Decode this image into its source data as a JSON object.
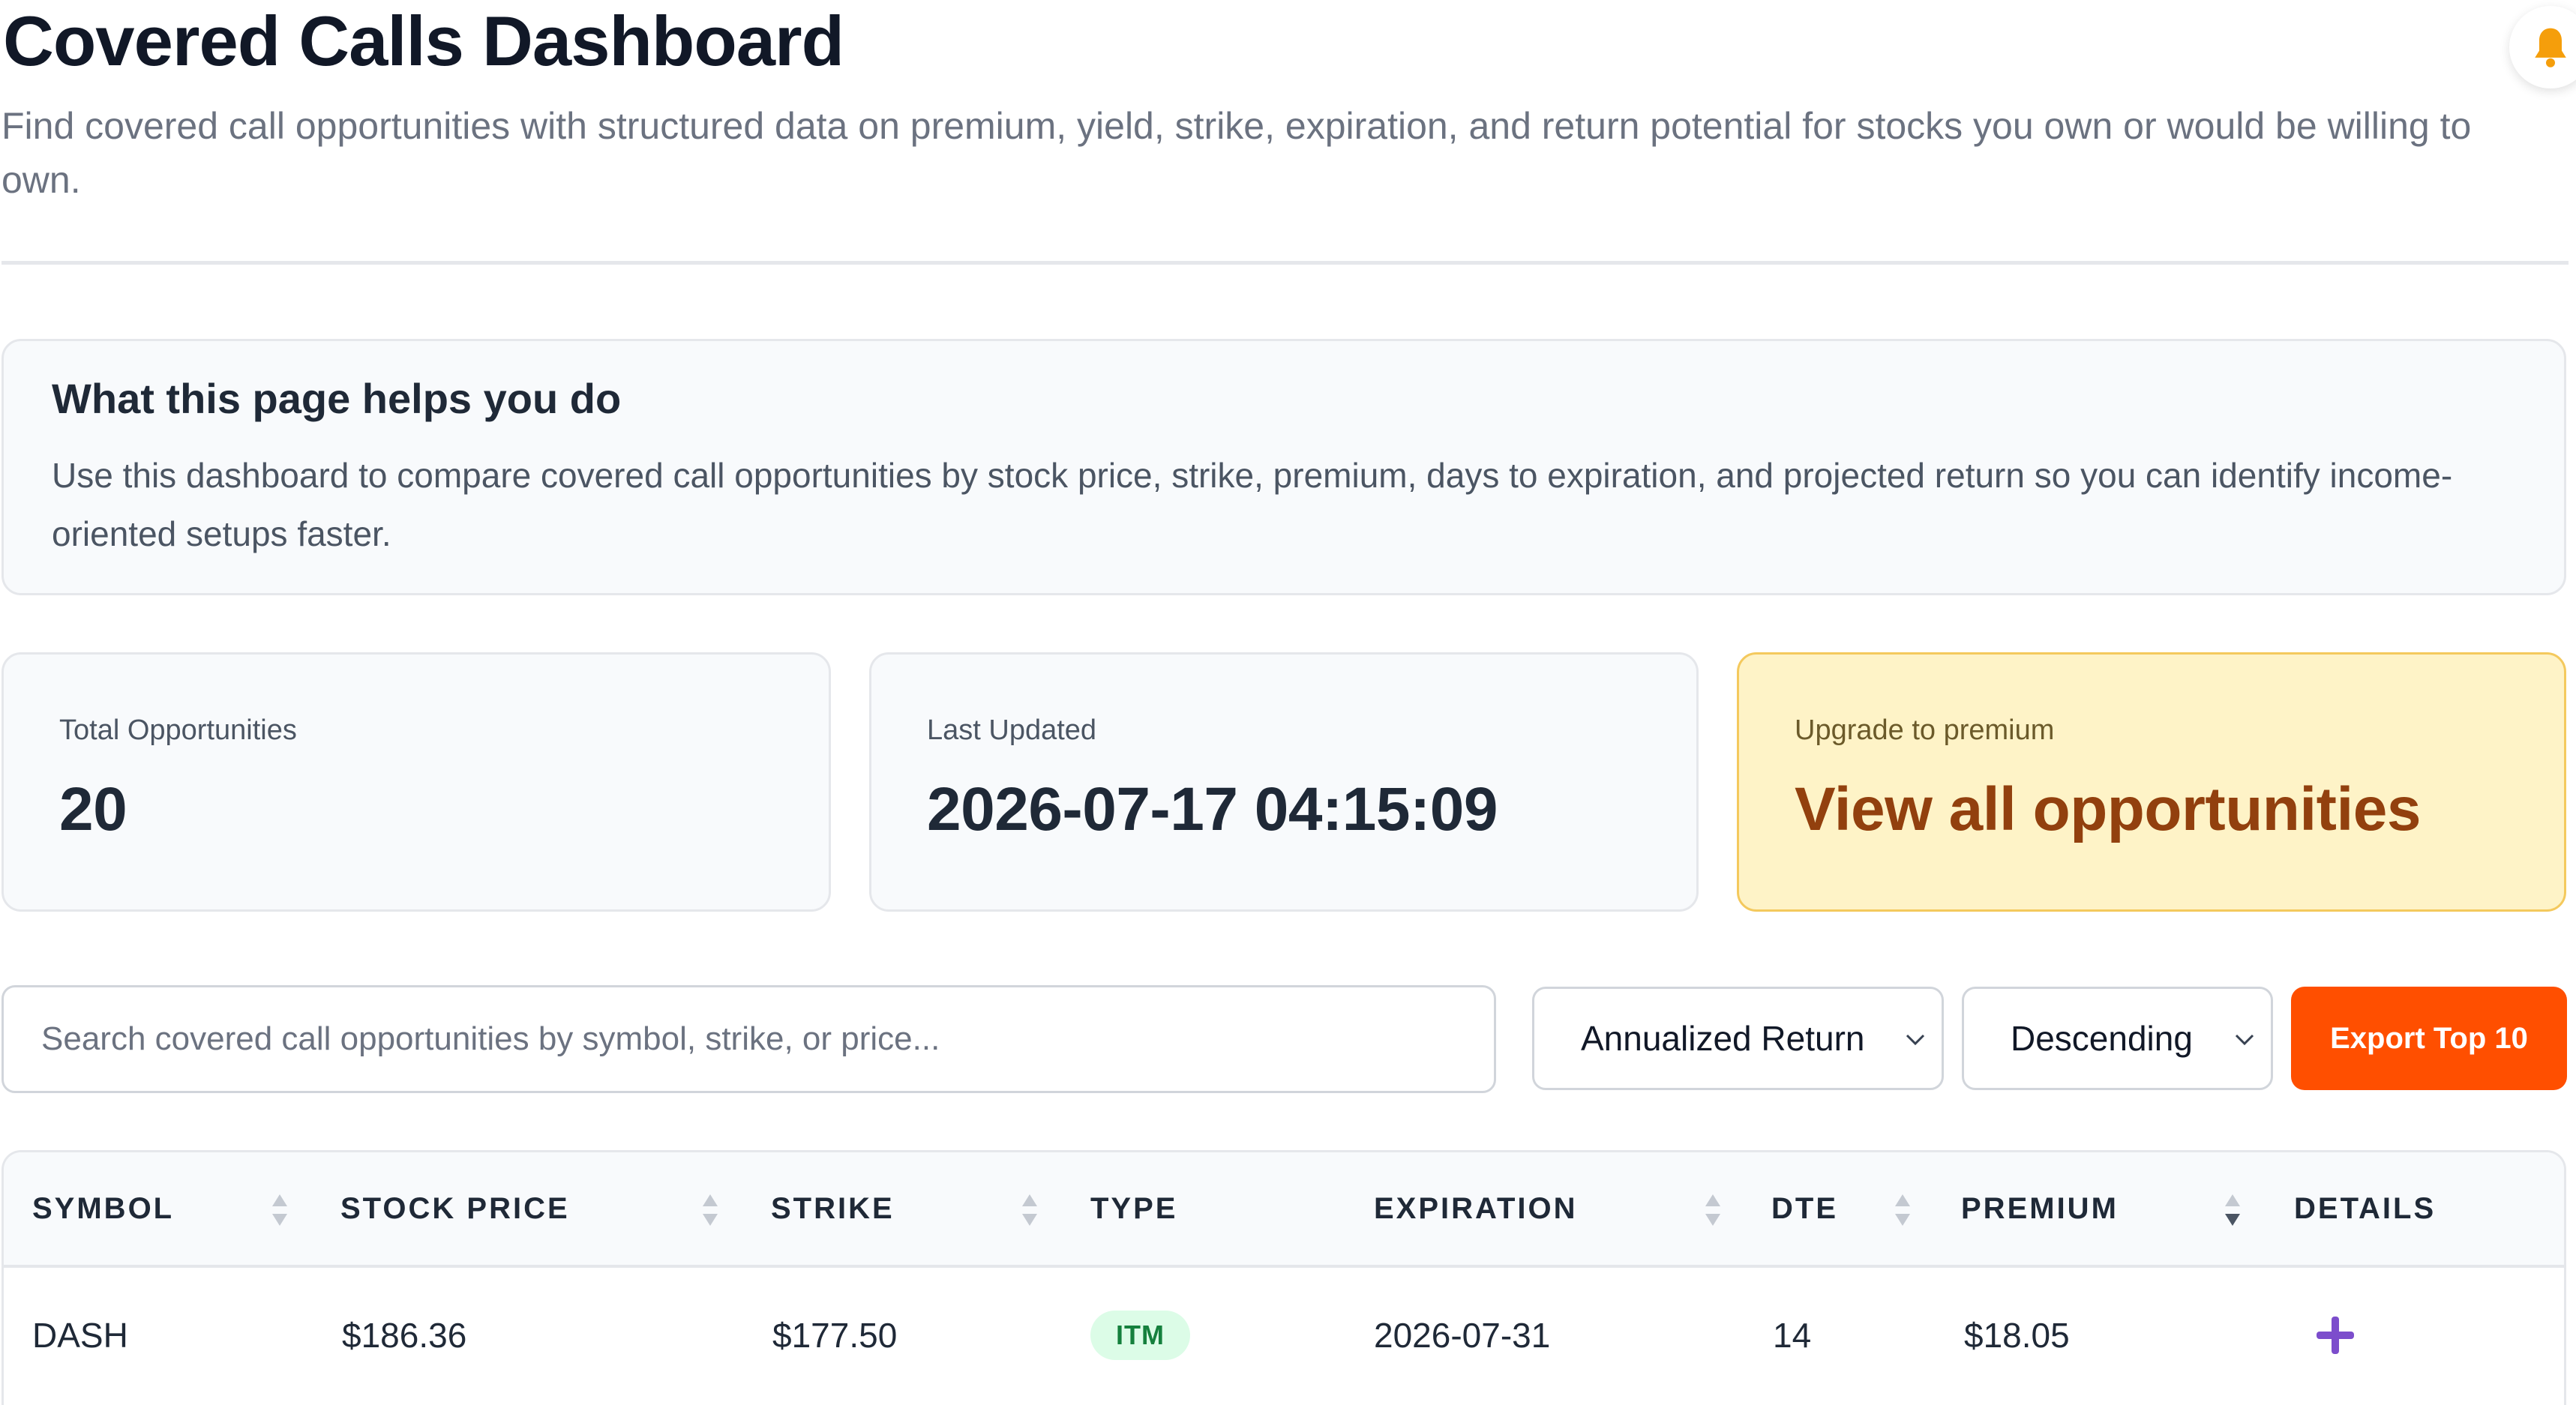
{
  "header": {
    "title": "Covered Calls Dashboard",
    "subtitle": "Find covered call opportunities with structured data on premium, yield, strike, expiration, and return potential for stocks you own or would be willing to own."
  },
  "notifications": {
    "icon": "bell-icon"
  },
  "help_box": {
    "title": "What this page helps you do",
    "text": "Use this dashboard to compare covered call opportunities by stock price, strike, premium, days to expiration, and projected return so you can identify income-oriented setups faster."
  },
  "stats": {
    "total": {
      "label": "Total Opportunities",
      "value": "20"
    },
    "updated": {
      "label": "Last Updated",
      "value": "2026-07-17 04:15:09"
    },
    "premium": {
      "label": "Upgrade to premium",
      "value": "View all opportunities"
    }
  },
  "controls": {
    "search_placeholder": "Search covered call opportunities by symbol, strike, or price...",
    "sort_field": "Annualized Return",
    "sort_order": "Descending",
    "export_label": "Export Top 10"
  },
  "table": {
    "columns": [
      "SYMBOL",
      "STOCK PRICE",
      "STRIKE",
      "TYPE",
      "EXPIRATION",
      "DTE",
      "PREMIUM",
      "DETAILS"
    ],
    "rows": [
      {
        "symbol": "DASH",
        "stock_price": "$186.36",
        "strike": "$177.50",
        "type": "ITM",
        "expiration": "2026-07-31",
        "dte": "14",
        "premium": "$18.05",
        "details_icon": "plus-icon"
      }
    ]
  },
  "colors": {
    "accent": "#ff4f00",
    "premium_bg": "#fef3c7",
    "premium_text": "#92400e",
    "itm_badge_bg": "#dcfce7",
    "itm_badge_text": "#15803d",
    "details_plus": "#7c4dcc"
  }
}
